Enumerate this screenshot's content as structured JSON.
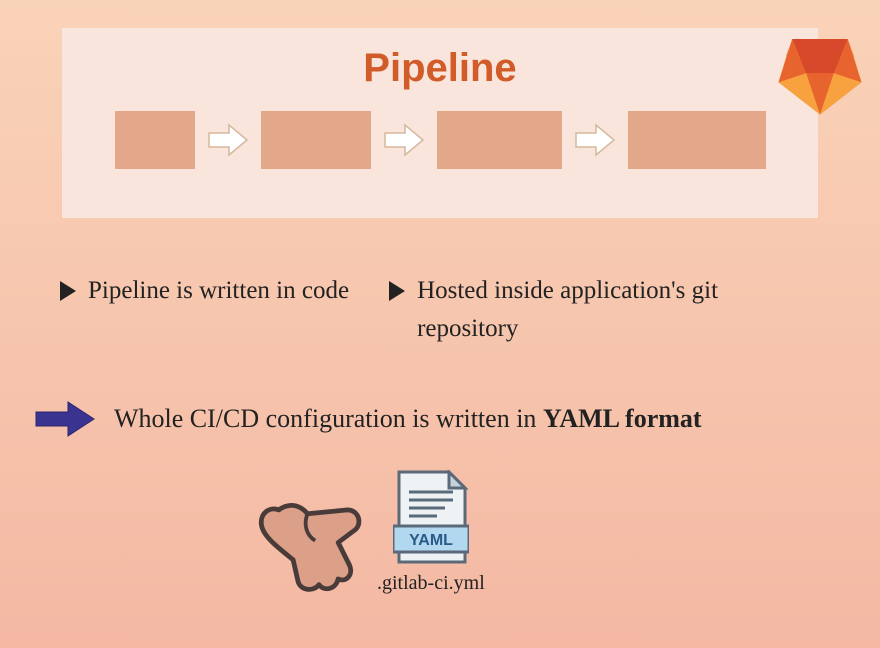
{
  "pipeline": {
    "title": "Pipeline"
  },
  "bullets": {
    "left": "Pipeline is written in code",
    "right": "Hosted inside application's git repository"
  },
  "callout": {
    "prefix": "Whole CI/CD configuration is written in ",
    "strong": "YAML format"
  },
  "file": {
    "badge": "YAML",
    "name": ".gitlab-ci.yml"
  }
}
